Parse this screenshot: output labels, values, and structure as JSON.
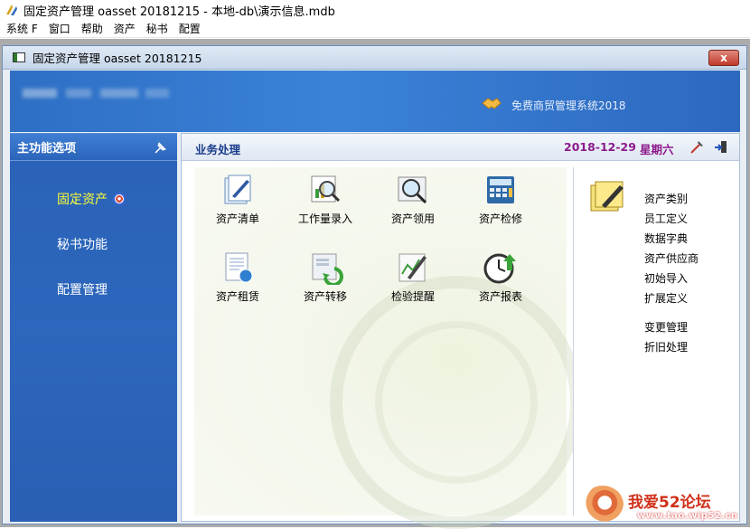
{
  "app": {
    "title": "固定资产管理 oasset 20181215 - 本地-db\\演示信息.mdb"
  },
  "menubar": {
    "items": [
      "系统 F",
      "窗口",
      "帮助",
      "资产",
      "秘书",
      "配置"
    ]
  },
  "child_window": {
    "title": "固定资产管理 oasset 20181215",
    "close_label": "x"
  },
  "banner": {
    "slogan": "免费商贸管理系统2018"
  },
  "leftnav": {
    "header": "主功能选项",
    "items": [
      {
        "label": "固定资产",
        "active": true
      },
      {
        "label": "秘书功能",
        "active": false
      },
      {
        "label": "配置管理",
        "active": false
      }
    ]
  },
  "content": {
    "tab": "业务处理",
    "date": "2018-12-29",
    "weekday": "星期六",
    "functions": [
      {
        "label": "资产清单",
        "icon": "document-pen-icon"
      },
      {
        "label": "工作量录入",
        "icon": "magnifier-report-icon"
      },
      {
        "label": "资产领用",
        "icon": "magnifier-icon"
      },
      {
        "label": "资产检修",
        "icon": "calculator-icon"
      },
      {
        "label": "资产租赁",
        "icon": "document-globe-icon"
      },
      {
        "label": "资产转移",
        "icon": "transfer-arrow-icon"
      },
      {
        "label": "检验提醒",
        "icon": "chart-pen-icon"
      },
      {
        "label": "资产报表",
        "icon": "clock-arrow-icon"
      }
    ],
    "side_items": [
      "资产类别",
      "员工定义",
      "数据字典",
      "资产供应商",
      "初始导入",
      "扩展定义",
      "变更管理",
      "折旧处理"
    ]
  },
  "watermark": {
    "title": "我爱52论坛",
    "url": "www.tao.wip52.cn"
  },
  "colors": {
    "nav_bg": "#2c67bd",
    "active_nav": "#ffff33",
    "date_color": "#8c1a8c"
  }
}
